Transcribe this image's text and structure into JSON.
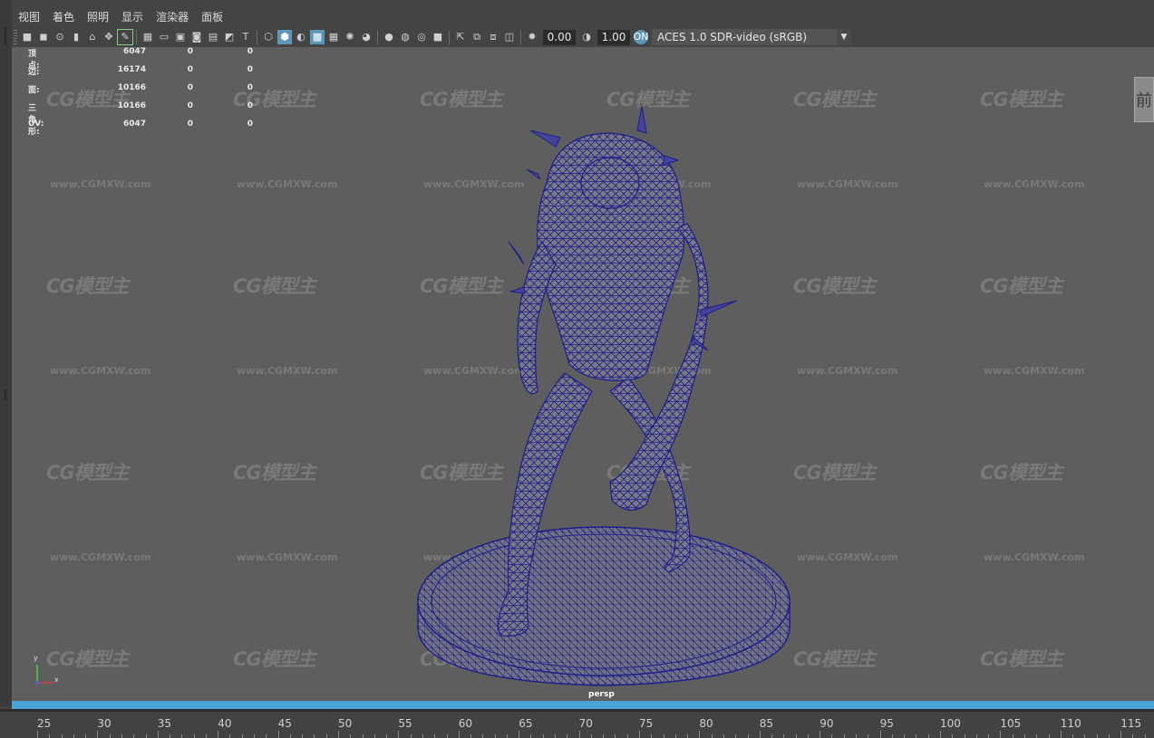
{
  "menu": [
    "视图",
    "着色",
    "照明",
    "显示",
    "渲染器",
    "面板"
  ],
  "toolbar": {
    "exposure": "0.00",
    "gamma": "1.00",
    "color_space": "ACES 1.0 SDR-video (sRGB)"
  },
  "hud": [
    {
      "label": "顶点:",
      "v1": "6047",
      "v2": "0",
      "v3": "0"
    },
    {
      "label": "边:",
      "v1": "16174",
      "v2": "0",
      "v3": "0"
    },
    {
      "label": "面:",
      "v1": "10166",
      "v2": "0",
      "v3": "0"
    },
    {
      "label": "三角形:",
      "v1": "10166",
      "v2": "0",
      "v3": "0"
    },
    {
      "label": "UV:",
      "v1": "6047",
      "v2": "0",
      "v3": "0"
    }
  ],
  "viewport": {
    "camera_label": "persp",
    "view_cube_label": "前",
    "watermark_logo": "CG模型主",
    "watermark_url": "www.CGMXW.com",
    "axis": {
      "y": "y",
      "x": "x"
    }
  },
  "timeline": {
    "ticks": [
      "25",
      "30",
      "35",
      "40",
      "45",
      "50",
      "55",
      "60",
      "65",
      "70",
      "75",
      "80",
      "85",
      "90",
      "95",
      "100",
      "105",
      "110",
      "115"
    ]
  },
  "colors": {
    "viewport_bg": "#5e5e5e",
    "wireframe": "#1e1e8a",
    "mesh_fill": "#7a7a86",
    "selection_bar": "#4aa3d6",
    "active_icon": "#5c97b8"
  },
  "icons": [
    "camera-select-icon",
    "camera-lock-icon",
    "bookmark-icon",
    "grid-icon",
    "film-gate-icon",
    "resolution-gate-icon",
    "wireframe-icon",
    "smooth-shade-icon",
    "textured-icon",
    "xray-icon",
    "lights-icon",
    "shadows-icon",
    "ambient-occlusion-icon",
    "isolate-select-icon",
    "exposure-icon",
    "gamma-icon",
    "color-management-icon"
  ]
}
